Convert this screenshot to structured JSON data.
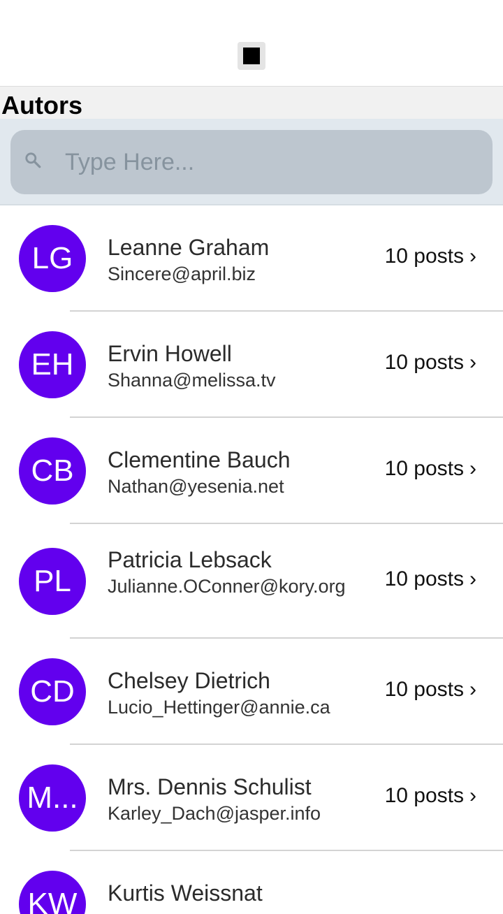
{
  "header": {
    "section_title": "Autors"
  },
  "search": {
    "placeholder": "Type Here...",
    "value": ""
  },
  "authors": [
    {
      "initials": "LG",
      "name": "Leanne Graham",
      "email": "Sincere@april.biz",
      "posts": "10 posts"
    },
    {
      "initials": "EH",
      "name": "Ervin Howell",
      "email": "Shanna@melissa.tv",
      "posts": "10 posts"
    },
    {
      "initials": "CB",
      "name": "Clementine Bauch",
      "email": "Nathan@yesenia.net",
      "posts": "10 posts"
    },
    {
      "initials": "PL",
      "name": "Patricia Lebsack",
      "email": "Julianne.OConner@kory.org",
      "posts": "10 posts"
    },
    {
      "initials": "CD",
      "name": "Chelsey Dietrich",
      "email": "Lucio_Hettinger@annie.ca",
      "posts": "10 posts"
    },
    {
      "initials": "M...",
      "name": "Mrs. Dennis Schulist",
      "email": "Karley_Dach@jasper.info",
      "posts": "10 posts"
    },
    {
      "initials": "KW",
      "name": "Kurtis Weissnat",
      "email": "",
      "posts": ""
    }
  ],
  "chevron": "›",
  "colors": {
    "avatar": "#6200ee",
    "search_bar_bg": "#e1e8ee",
    "search_box": "#bdc6cf"
  }
}
